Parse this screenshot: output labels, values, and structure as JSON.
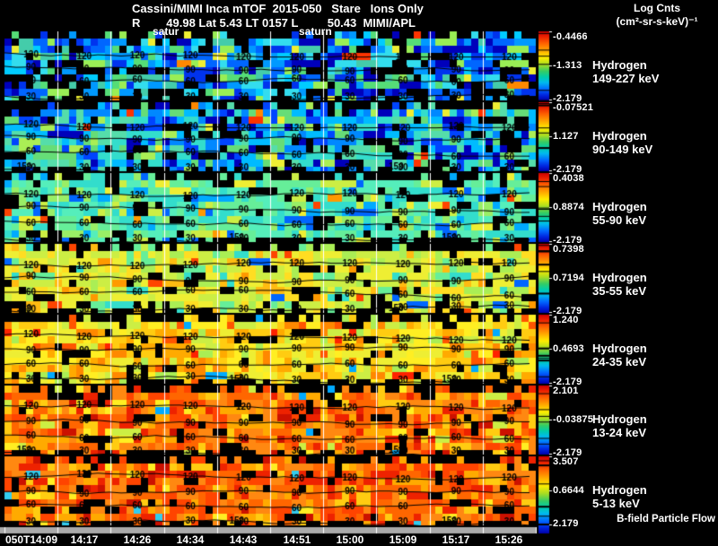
{
  "header": {
    "title": "Cassini/MIMI Inca mTOF  2015-050   Stare   Ions Only",
    "subtitle": "R        49.98 Lat 5.43 LT 0157 L         50.43  MIMI/APL",
    "units_line1": "Log Cnts",
    "units_line2": "(cm²-sr-s-keV)⁻¹"
  },
  "markers": {
    "saturn_partial": "satur",
    "saturn": "saturn"
  },
  "bfield_label": "B-field Particle Flow",
  "contour_levels": [
    "120",
    "90",
    "60",
    "30"
  ],
  "extra_contour_label": "150",
  "time_axis": {
    "labels": [
      "050T14:09",
      "14:17",
      "14:26",
      "14:34",
      "14:43",
      "14:51",
      "15:00",
      "15:09",
      "15:17",
      "15:26"
    ]
  },
  "panels": [
    {
      "species": "Hydrogen",
      "energy": "149-227 keV",
      "cbar_top": "-0.4466",
      "cbar_mid": "-1.313",
      "cbar_bot": "-2.179",
      "palette": {
        "colors": [
          "#000000",
          "#0000bb",
          "#0033ee",
          "#0066ff",
          "#0099ff",
          "#00ccff",
          "#33ddee",
          "#44ccaa",
          "#55dd77",
          "#99ee55",
          "#eeee33",
          "#ff8800",
          "#ff3300"
        ],
        "weights": [
          18,
          8,
          10,
          10,
          8,
          8,
          8,
          6,
          6,
          4,
          2,
          1,
          1
        ]
      }
    },
    {
      "species": "Hydrogen",
      "energy": "90-149 keV",
      "cbar_top": "-0.07521",
      "cbar_mid": "1.127",
      "cbar_bot": "-2.179",
      "palette": {
        "colors": [
          "#000000",
          "#0000bb",
          "#0044ff",
          "#0088ff",
          "#00bbff",
          "#33ddcc",
          "#55ddaa",
          "#66dd77",
          "#aaee55",
          "#eeee33",
          "#ff8800",
          "#ff3300"
        ],
        "weights": [
          14,
          6,
          8,
          8,
          8,
          10,
          9,
          6,
          4,
          2,
          1,
          1
        ]
      }
    },
    {
      "species": "Hydrogen",
      "energy": "55-90 keV",
      "cbar_top": "0.4038",
      "cbar_mid": "0.8874",
      "cbar_bot": "-2.179",
      "palette": {
        "colors": [
          "#000000",
          "#0066ff",
          "#00aaff",
          "#33ddcc",
          "#55eebb",
          "#66ee99",
          "#99ee66",
          "#ccee44",
          "#eeee33",
          "#ff9900",
          "#ff4400"
        ],
        "weights": [
          8,
          4,
          5,
          14,
          14,
          10,
          6,
          4,
          3,
          1,
          1
        ]
      }
    },
    {
      "species": "Hydrogen",
      "energy": "35-55 keV",
      "cbar_top": "0.7398",
      "cbar_mid": "0.7194",
      "cbar_bot": "-2.179",
      "palette": {
        "colors": [
          "#000000",
          "#33ddcc",
          "#66ee99",
          "#aaee55",
          "#ccee44",
          "#eeee33",
          "#ffdd22",
          "#ffbb11",
          "#ff9900",
          "#ff4400",
          "#0066ff"
        ],
        "weights": [
          7,
          3,
          4,
          8,
          12,
          14,
          8,
          4,
          2,
          1,
          1
        ]
      }
    },
    {
      "species": "Hydrogen",
      "energy": "24-35 keV",
      "cbar_top": "1.240",
      "cbar_mid": "0.4693",
      "cbar_bot": "-2.179",
      "palette": {
        "colors": [
          "#000000",
          "#aaee55",
          "#ccee44",
          "#eeee33",
          "#ffee22",
          "#ffcc11",
          "#ffaa00",
          "#ff8800",
          "#ff5500",
          "#ff2200",
          "#00aaff"
        ],
        "weights": [
          6,
          3,
          5,
          8,
          10,
          12,
          8,
          5,
          2,
          1,
          1
        ]
      }
    },
    {
      "species": "Hydrogen",
      "energy": "13-24 keV",
      "cbar_top": "2.101",
      "cbar_mid": "-0.03875",
      "cbar_bot": "-2.179",
      "palette": {
        "colors": [
          "#000000",
          "#ccee44",
          "#ffee22",
          "#ffcc11",
          "#ffaa00",
          "#ff8811",
          "#ff6600",
          "#ff4400",
          "#ee2200",
          "#cc1100",
          "#00aaff"
        ],
        "weights": [
          6,
          1,
          3,
          6,
          8,
          12,
          12,
          8,
          4,
          2,
          1
        ]
      }
    },
    {
      "species": "Hydrogen",
      "energy": "5-13 keV",
      "cbar_top": "3.507",
      "cbar_mid": "0.6644",
      "cbar_bot": "2.179",
      "palette": {
        "colors": [
          "#000000",
          "#ffee22",
          "#ffcc11",
          "#ffaa00",
          "#ff8811",
          "#ff6600",
          "#ff4400",
          "#ee2200",
          "#cc1100",
          "#33ccee"
        ],
        "weights": [
          6,
          2,
          4,
          7,
          10,
          12,
          10,
          6,
          2,
          1
        ]
      }
    }
  ],
  "colorbar_gradient": [
    [
      0,
      "#cc0000"
    ],
    [
      0.08,
      "#ee2200"
    ],
    [
      0.18,
      "#ff6600"
    ],
    [
      0.28,
      "#ffaa00"
    ],
    [
      0.38,
      "#ffee00"
    ],
    [
      0.48,
      "#aadd22"
    ],
    [
      0.58,
      "#33cc66"
    ],
    [
      0.66,
      "#00ccaa"
    ],
    [
      0.74,
      "#00bbee"
    ],
    [
      0.84,
      "#0066ff"
    ],
    [
      0.93,
      "#0022dd"
    ],
    [
      1,
      "#0000aa"
    ]
  ],
  "axis_bar_color": "#aaaaaa",
  "chart_data": {
    "type": "heatmap",
    "title": "Cassini/MIMI Inca mTOF 2015-050 Stare Ions Only",
    "subtitle": "R 49.98 Lat 5.43 LT 0157 L 50.43 MIMI/APL",
    "colorbar_label": "Log Cnts (cm²-sr-s-keV)⁻¹",
    "x_tick_labels": [
      "050T14:09",
      "14:17",
      "14:26",
      "14:34",
      "14:43",
      "14:51",
      "15:00",
      "15:09",
      "15:17",
      "15:26"
    ],
    "contour_levels_deg": [
      30,
      60,
      90,
      120,
      150
    ],
    "legend_position": "right",
    "grid": false,
    "panels": [
      {
        "series": "Hydrogen 149-227 keV",
        "colorbar_max": -0.4466,
        "colorbar_mid": -1.313,
        "colorbar_min": -2.179,
        "dominant_color": "blue"
      },
      {
        "series": "Hydrogen 90-149 keV",
        "colorbar_max": -0.07521,
        "colorbar_mid": 1.127,
        "colorbar_min": -2.179,
        "dominant_color": "blue-cyan"
      },
      {
        "series": "Hydrogen 55-90 keV",
        "colorbar_max": 0.4038,
        "colorbar_mid": 0.8874,
        "colorbar_min": -2.179,
        "dominant_color": "cyan-green"
      },
      {
        "series": "Hydrogen 35-55 keV",
        "colorbar_max": 0.7398,
        "colorbar_mid": 0.7194,
        "colorbar_min": -2.179,
        "dominant_color": "yellow-green"
      },
      {
        "series": "Hydrogen 24-35 keV",
        "colorbar_max": 1.24,
        "colorbar_mid": 0.4693,
        "colorbar_min": -2.179,
        "dominant_color": "yellow-orange"
      },
      {
        "series": "Hydrogen 13-24 keV",
        "colorbar_max": 2.101,
        "colorbar_mid": -0.03875,
        "colorbar_min": -2.179,
        "dominant_color": "orange-red"
      },
      {
        "series": "Hydrogen 5-13 keV",
        "colorbar_max": 3.507,
        "colorbar_mid": 0.6644,
        "colorbar_min": 2.179,
        "dominant_color": "orange-red"
      }
    ]
  }
}
